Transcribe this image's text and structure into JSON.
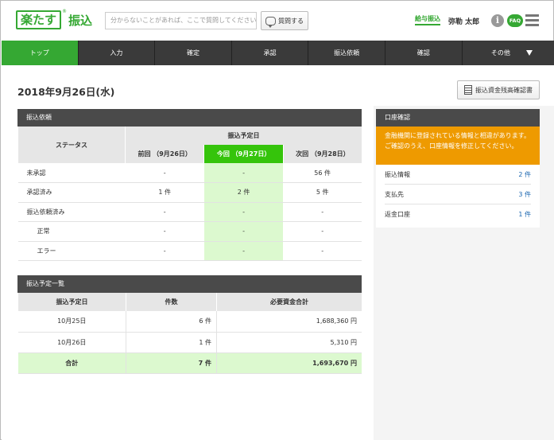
{
  "header": {
    "logo_main": "楽たす",
    "logo_reg": "®",
    "logo_sub": "振込",
    "search_placeholder": "分からないことがあれば、ここで質問してください",
    "ask_button": "質問する",
    "salary_link": "給与振込",
    "user_name": "弥勒 太郎",
    "info_label": "i",
    "faq_label": "FAQ"
  },
  "nav": {
    "items": [
      "トップ",
      "入力",
      "確定",
      "承認",
      "振込依頼",
      "確認",
      "その他"
    ],
    "active_index": 0
  },
  "page": {
    "date_title": "2018年9月26日(水)",
    "balance_button": "振込資金残高確認書"
  },
  "transfer_requests": {
    "title": "振込依頼",
    "status_header": "ステータス",
    "scheduled_header": "振込予定日",
    "columns": [
      "前回 （9月26日）",
      "今回 （9月27日）",
      "次回 （9月28日）"
    ],
    "rows": [
      {
        "label": "未承認",
        "link": true,
        "values": [
          "-",
          "-",
          "56 件"
        ]
      },
      {
        "label": "承認済み",
        "link": true,
        "values": [
          "1 件",
          "2 件",
          "5 件"
        ]
      },
      {
        "label": "振込依頼済み",
        "link": true,
        "values": [
          "-",
          "-",
          "-"
        ]
      },
      {
        "label": "正常",
        "link": false,
        "values": [
          "-",
          "-",
          "-"
        ]
      },
      {
        "label": "エラー",
        "link": false,
        "values": [
          "-",
          "-",
          "-"
        ]
      }
    ]
  },
  "schedule": {
    "title": "振込予定一覧",
    "headers": [
      "振込予定日",
      "件数",
      "必要資金合計"
    ],
    "rows": [
      {
        "date": "10月25日",
        "count": "6 件",
        "amount": "1,688,360 円"
      },
      {
        "date": "10月26日",
        "count": "1 件",
        "amount": "5,310 円"
      }
    ],
    "total": {
      "date": "合計",
      "count": "7 件",
      "amount": "1,693,670 円"
    }
  },
  "account_check": {
    "title": "口座確認",
    "alert_line1": "金融機関に登録されている情報と相違があります。",
    "alert_line2": "ご確認のうえ、口座情報を修正してください。",
    "items": [
      {
        "label": "振込情報",
        "value": "2 件"
      },
      {
        "label": "支払先",
        "value": "3 件"
      },
      {
        "label": "返金口座",
        "value": "1 件"
      }
    ]
  },
  "colors": {
    "brand_green": "#35a833",
    "today_green": "#35c40b",
    "highlight_green": "#dcf9cf",
    "alert_orange": "#ee9a00",
    "link_blue": "#1a66b0",
    "nav_dark": "#3a3a3a"
  }
}
